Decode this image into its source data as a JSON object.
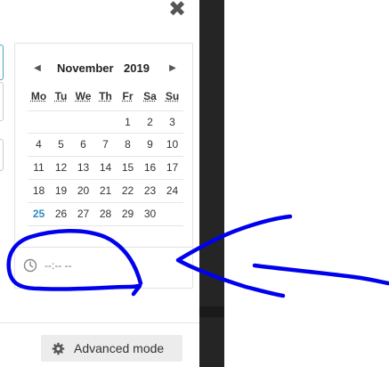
{
  "dialog": {
    "close_symbol": "✖"
  },
  "calendar": {
    "month": "November",
    "year": "2019",
    "prev_icon": "triangle-left-icon",
    "next_icon": "triangle-right-icon",
    "weekdays": [
      "Mo",
      "Tu",
      "We",
      "Th",
      "Fr",
      "Sa",
      "Su"
    ],
    "weeks": [
      [
        "",
        "",
        "",
        "",
        "1",
        "2",
        "3"
      ],
      [
        "4",
        "5",
        "6",
        "7",
        "8",
        "9",
        "10"
      ],
      [
        "11",
        "12",
        "13",
        "14",
        "15",
        "16",
        "17"
      ],
      [
        "18",
        "19",
        "20",
        "21",
        "22",
        "23",
        "24"
      ],
      [
        "25",
        "26",
        "27",
        "28",
        "29",
        "30",
        ""
      ]
    ],
    "today": "25",
    "today_color": "#2b8cbe"
  },
  "time": {
    "icon": "clock-icon",
    "placeholder": "--:-- --"
  },
  "footer": {
    "advanced_icon": "gear-icon",
    "advanced_label": "Advanced mode"
  },
  "annotation": {
    "ink_color": "#0000ee"
  }
}
